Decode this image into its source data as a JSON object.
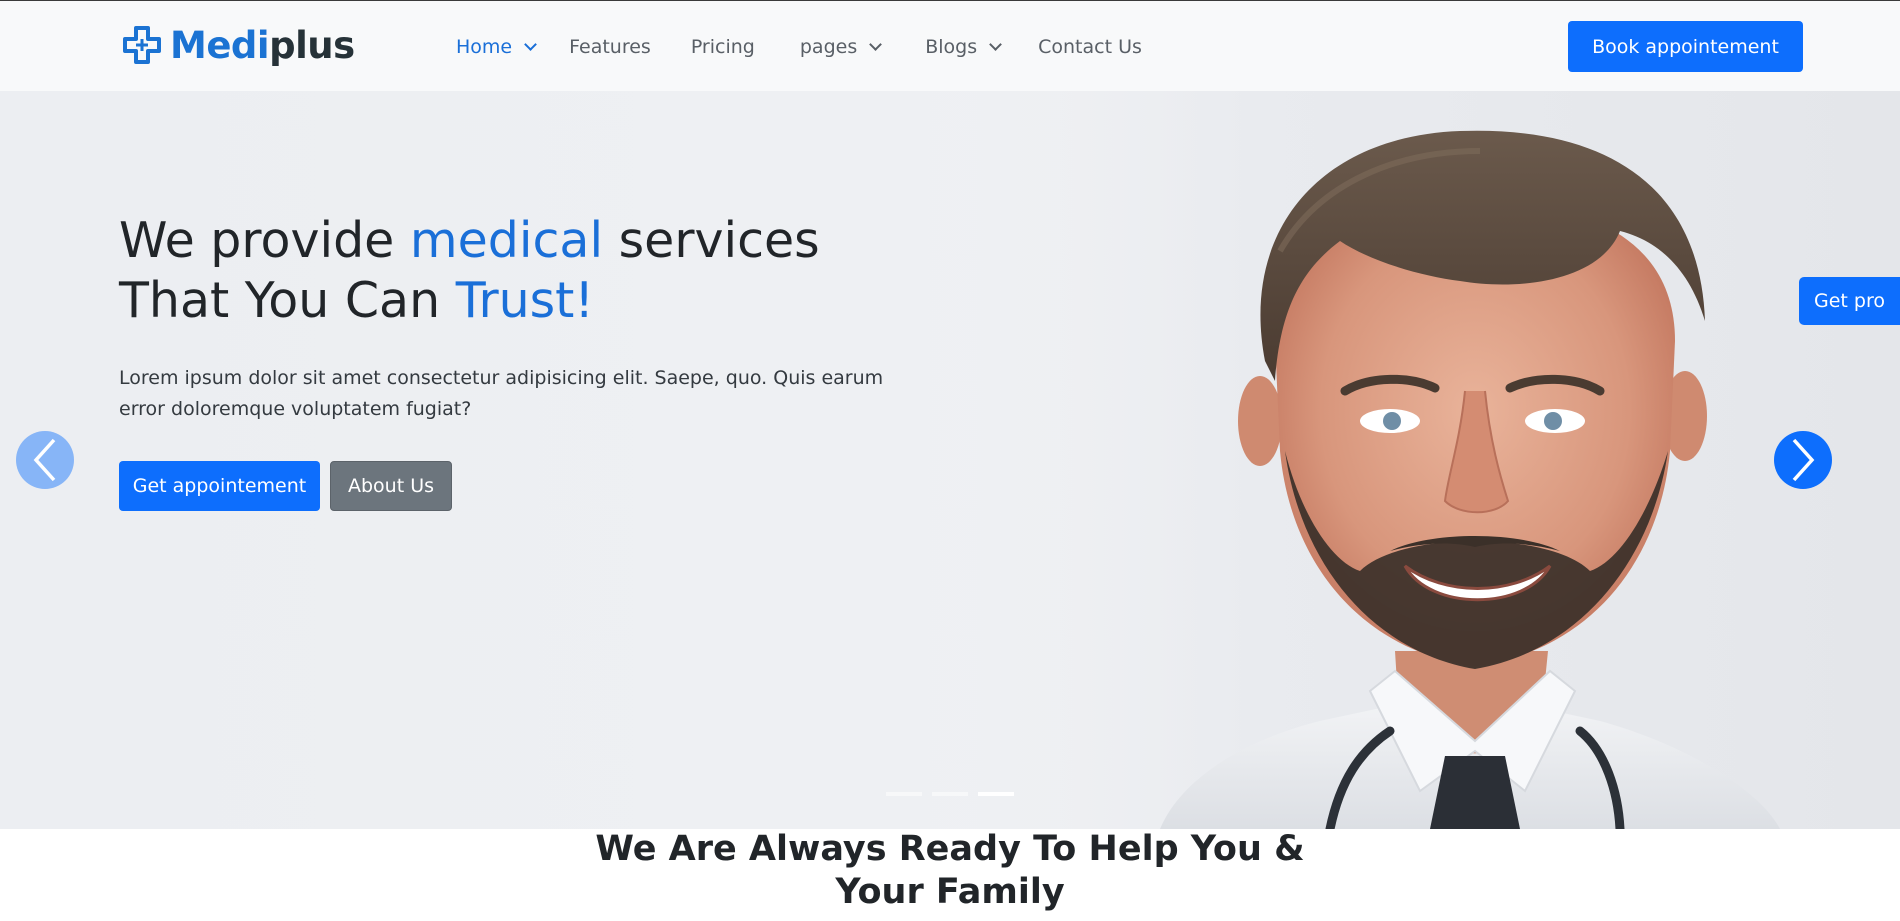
{
  "brand": {
    "name_part1": "Medi",
    "name_part2": "plus",
    "accent_color": "#1b73d3"
  },
  "nav": {
    "items": [
      {
        "label": "Home",
        "active": true,
        "has_dropdown": true
      },
      {
        "label": "Features",
        "active": false,
        "has_dropdown": false
      },
      {
        "label": "Pricing",
        "active": false,
        "has_dropdown": false
      },
      {
        "label": "pages",
        "active": false,
        "has_dropdown": true
      },
      {
        "label": "Blogs",
        "active": false,
        "has_dropdown": true
      },
      {
        "label": "Contact Us",
        "active": false,
        "has_dropdown": false
      }
    ],
    "book_button": "Book appointement"
  },
  "hero": {
    "title_part1": "We provide ",
    "title_accent1": "medical",
    "title_part2": " services That You Can ",
    "title_accent2": "Trust!",
    "description": "Lorem ipsum dolor sit amet consectetur adipisicing elit. Saepe, quo. Quis earum error doloremque voluptatem fugiat?",
    "primary_button": "Get appointement",
    "secondary_button": "About Us",
    "slides_total": 3,
    "active_slide": 3
  },
  "side_badge": "Get pro",
  "section": {
    "title": "We Are Always Ready To Help You & Your Family"
  },
  "colors": {
    "primary": "#0d6efd",
    "secondary": "#6c757d",
    "accent_text": "#1a6fd8"
  },
  "icons": [
    "cross-logo-icon",
    "chevron-down-icon",
    "chevron-left-icon",
    "chevron-right-icon"
  ]
}
